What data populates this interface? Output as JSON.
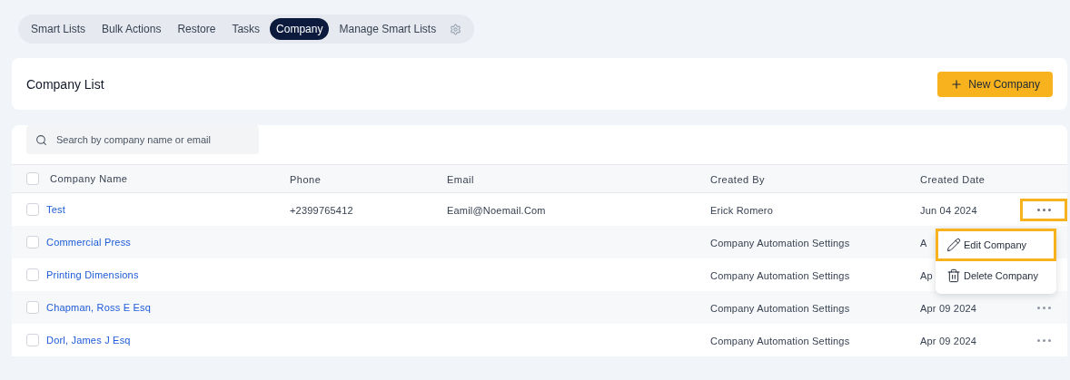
{
  "tabs": [
    {
      "label": "Smart Lists",
      "selected": false
    },
    {
      "label": "Bulk Actions",
      "selected": false
    },
    {
      "label": "Restore",
      "selected": false
    },
    {
      "label": "Tasks",
      "selected": false
    },
    {
      "label": "Company",
      "selected": true
    },
    {
      "label": "Manage Smart Lists",
      "selected": false
    }
  ],
  "header": {
    "title": "Company List",
    "new_button": "New Company"
  },
  "search": {
    "placeholder": "Search by company name or email"
  },
  "table": {
    "columns": [
      "Company Name",
      "Phone",
      "Email",
      "Created By",
      "Created Date"
    ],
    "header_checked": false,
    "rows": [
      {
        "name": "Test",
        "phone": "+2399765412",
        "email": "Eamil@Noemail.Com",
        "created_by": "Erick Romero",
        "created_date": "Jun 04 2024",
        "checked": false,
        "highlighted": true,
        "menu_open": true
      },
      {
        "name": "Commercial Press",
        "created_by": "Company Automation Settings",
        "created_date": "A",
        "checked": false,
        "highlighted": false,
        "menu_open": false
      },
      {
        "name": "Printing Dimensions",
        "created_by": "Company Automation Settings",
        "created_date": "Ap",
        "checked": false,
        "highlighted": false,
        "menu_open": false
      },
      {
        "name": "Chapman, Ross E Esq",
        "created_by": "Company Automation Settings",
        "created_date": "Apr 09 2024",
        "checked": false,
        "highlighted": false,
        "menu_open": false
      },
      {
        "name": "Dorl, James J Esq",
        "created_by": "Company Automation Settings",
        "created_date": "Apr 09 2024",
        "checked": false,
        "highlighted": false,
        "menu_open": false
      }
    ]
  },
  "row_menu": [
    {
      "kind": "edit",
      "label": "Edit Company",
      "highlighted": true
    },
    {
      "kind": "delete",
      "label": "Delete Company",
      "highlighted": false
    }
  ]
}
